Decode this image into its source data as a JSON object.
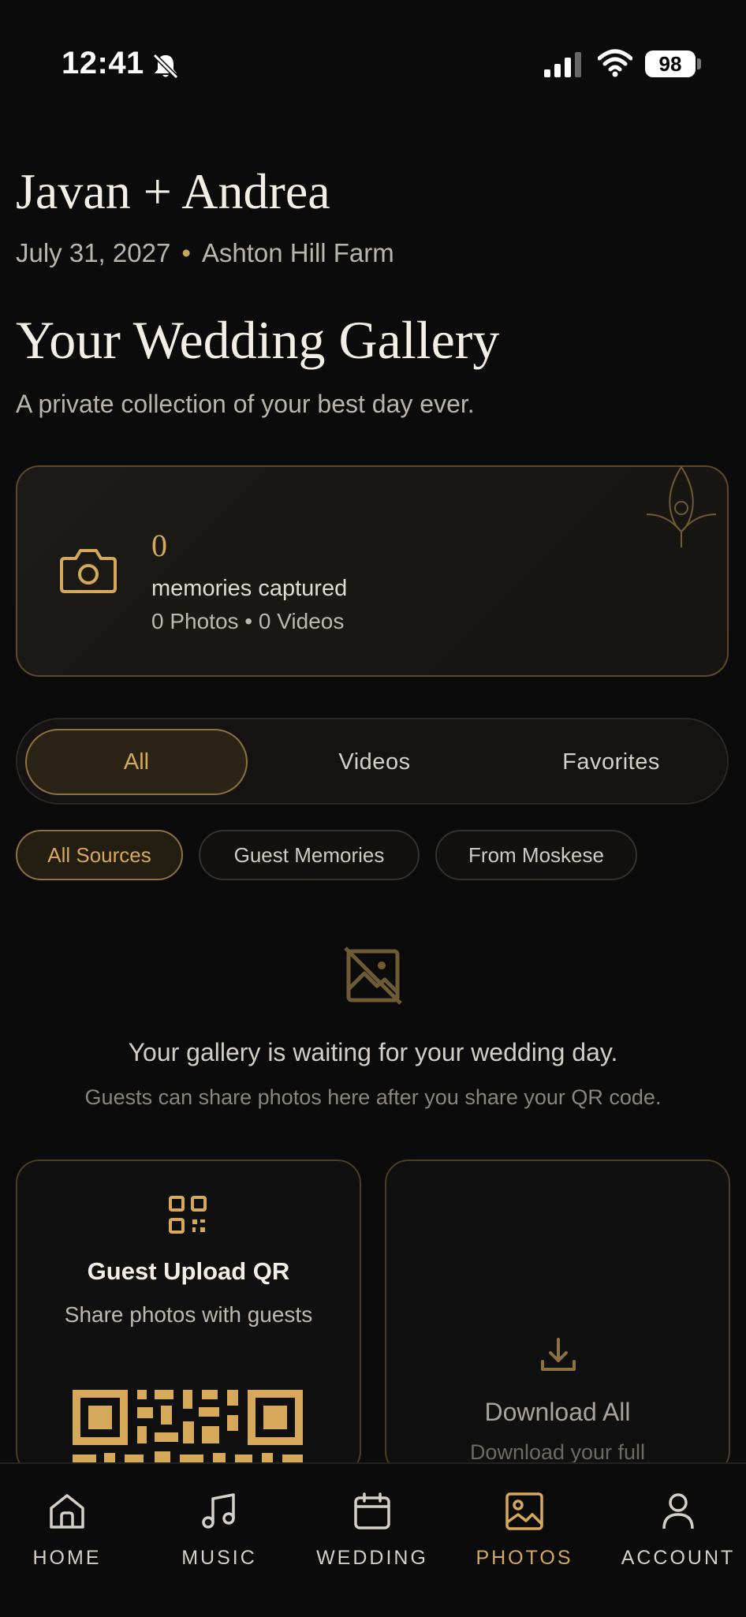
{
  "status": {
    "time": "12:41",
    "battery": "98"
  },
  "header": {
    "couple": "Javan + Andrea",
    "date": "July 31, 2027",
    "separator": "•",
    "venue": "Ashton Hill Farm"
  },
  "gallery": {
    "title": "Your Wedding Gallery",
    "subtitle": "A private collection of your best day ever."
  },
  "stats": {
    "count": "0",
    "label": "memories captured",
    "detail": "0 Photos • 0 Videos"
  },
  "tabs": [
    {
      "label": "All",
      "active": true
    },
    {
      "label": "Videos",
      "active": false
    },
    {
      "label": "Favorites",
      "active": false
    }
  ],
  "chips": [
    {
      "label": "All Sources",
      "active": true
    },
    {
      "label": "Guest Memories",
      "active": false
    },
    {
      "label": "From Moskese",
      "active": false
    }
  ],
  "empty": {
    "title": "Your gallery is waiting for your wedding day.",
    "subtitle": "Guests can share photos here after you share your QR code."
  },
  "cards": {
    "qr": {
      "title": "Guest Upload QR",
      "subtitle": "Share photos with guests"
    },
    "download": {
      "title": "Download All",
      "subtitle": "Download your full"
    }
  },
  "nav": [
    {
      "label": "HOME",
      "icon": "home-icon"
    },
    {
      "label": "MUSIC",
      "icon": "music-icon"
    },
    {
      "label": "WEDDING",
      "icon": "calendar-icon"
    },
    {
      "label": "PHOTOS",
      "icon": "image-icon",
      "active": true
    },
    {
      "label": "ACCOUNT",
      "icon": "user-icon"
    }
  ],
  "colors": {
    "accent": "#d6a85a",
    "background": "#0b0b0b",
    "border": "#5a4a2c"
  }
}
